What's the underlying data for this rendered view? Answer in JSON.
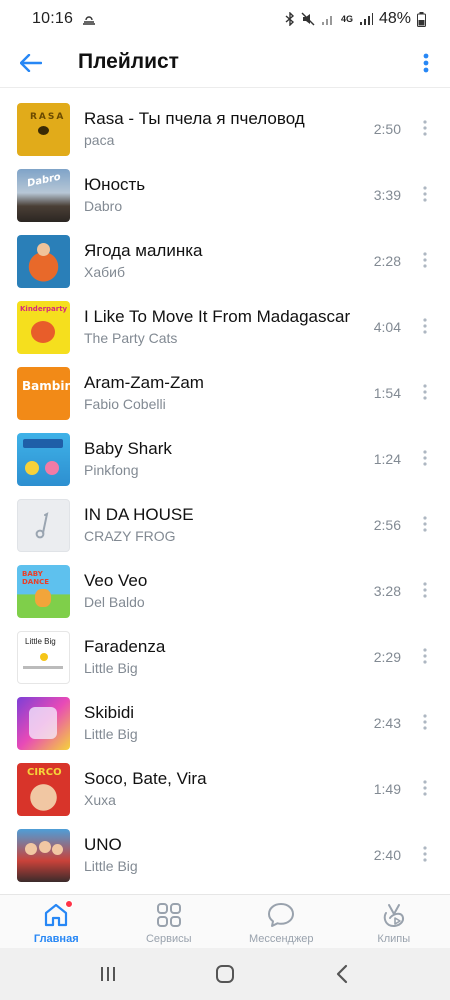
{
  "status_bar": {
    "time": "10:16",
    "battery": "48%",
    "network_label": "4G"
  },
  "header": {
    "title": "Плейлист"
  },
  "tracks": [
    {
      "title": "Rasa - Ты пчела я пчеловод",
      "artist": "раса",
      "duration": "2:50",
      "cover_text": "RASA"
    },
    {
      "title": "Юность",
      "artist": "Dabro",
      "duration": "3:39",
      "cover_text": "Dabro"
    },
    {
      "title": "Ягода малинка",
      "artist": "Хабиб",
      "duration": "2:28",
      "cover_text": ""
    },
    {
      "title": "I Like To Move It From Madagascar",
      "artist": "The Party Cats",
      "duration": "4:04",
      "cover_text": "Kinderparty"
    },
    {
      "title": "Aram-Zam-Zam",
      "artist": "Fabio Cobelli",
      "duration": "1:54",
      "cover_text": "Bambini"
    },
    {
      "title": "Baby Shark",
      "artist": "Pinkfong",
      "duration": "1:24",
      "cover_text": ""
    },
    {
      "title": "IN DA HOUSE",
      "artist": "CRAZY FROG",
      "duration": "2:56",
      "cover_text": ""
    },
    {
      "title": "Veo Veo",
      "artist": "Del Baldo",
      "duration": "3:28",
      "cover_text": "BABY DANCE"
    },
    {
      "title": "Faradenza",
      "artist": "Little Big",
      "duration": "2:29",
      "cover_text": "Little Big"
    },
    {
      "title": "Skibidi",
      "artist": "Little Big",
      "duration": "2:43",
      "cover_text": ""
    },
    {
      "title": "Soco, Bate, Vira",
      "artist": "Xuxa",
      "duration": "1:49",
      "cover_text": "CIRCO"
    },
    {
      "title": "UNO",
      "artist": "Little Big",
      "duration": "2:40",
      "cover_text": ""
    }
  ],
  "bottom_nav": [
    {
      "label": "Главная",
      "icon": "home-icon",
      "active": true
    },
    {
      "label": "Сервисы",
      "icon": "services-icon",
      "active": false
    },
    {
      "label": "Мессенджер",
      "icon": "messenger-icon",
      "active": false
    },
    {
      "label": "Клипы",
      "icon": "clips-icon",
      "active": false
    }
  ],
  "colors": {
    "accent": "#2787f5",
    "secondary_text": "#828a93",
    "nav_inactive": "#99a2ad",
    "badge": "#ff3347"
  }
}
